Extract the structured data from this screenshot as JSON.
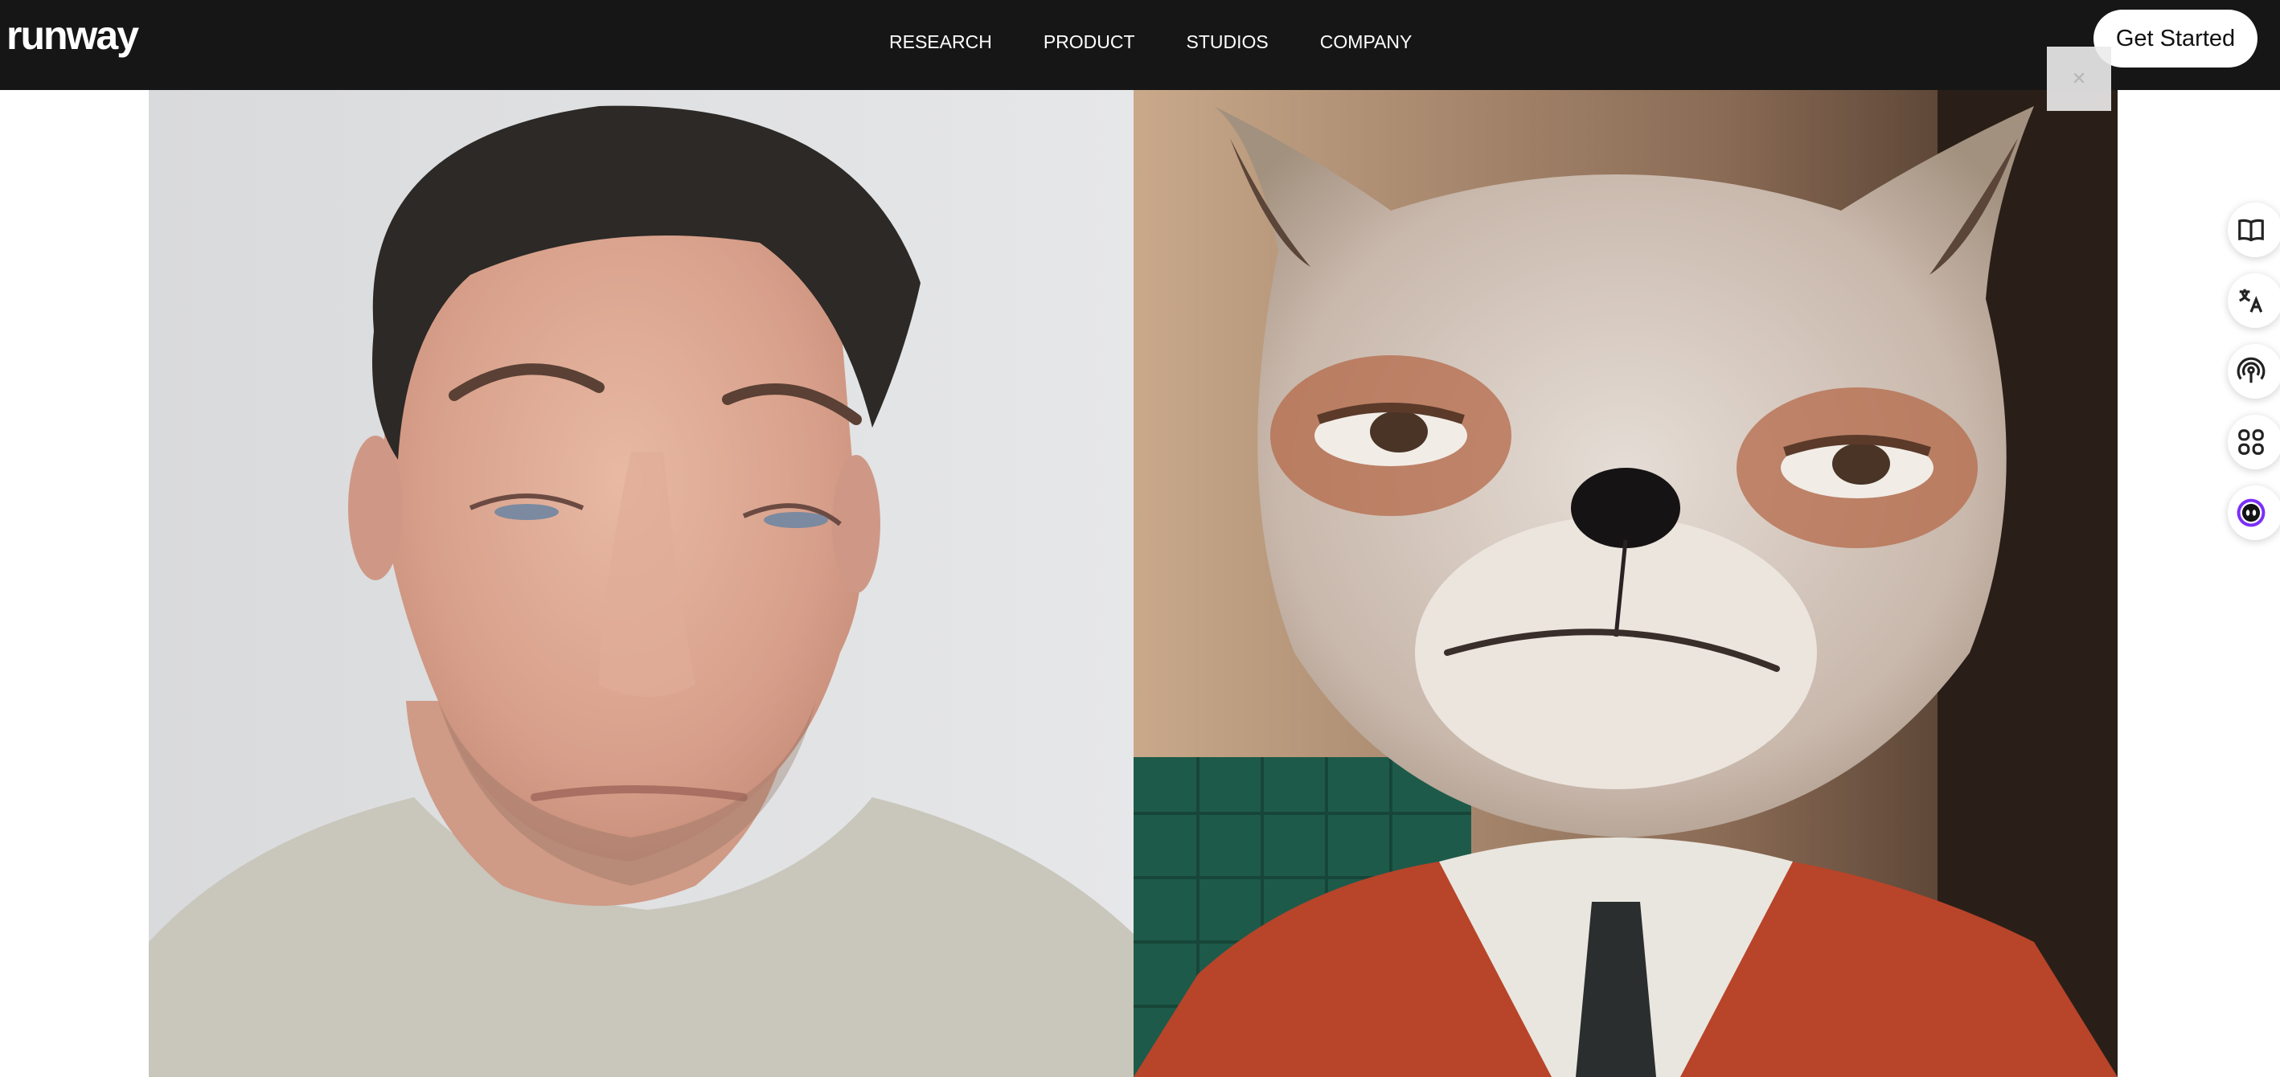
{
  "brand": {
    "logo_text": "runway"
  },
  "nav": {
    "items": [
      {
        "label": "RESEARCH"
      },
      {
        "label": "PRODUCT"
      },
      {
        "label": "STUDIOS"
      },
      {
        "label": "COMPANY"
      }
    ]
  },
  "header": {
    "cta_label": "Get Started"
  },
  "media": {
    "left_subject": "person-face",
    "right_subject": "stylized-fox-character"
  },
  "side_tools": {
    "items": [
      {
        "icon": "book-icon"
      },
      {
        "icon": "translate-icon"
      },
      {
        "icon": "podcast-icon"
      },
      {
        "icon": "apps-grid-icon"
      },
      {
        "icon": "assistant-icon"
      }
    ]
  },
  "colors": {
    "header_bg": "#161616",
    "cta_bg": "#ffffff",
    "fox_jacket": "#b8442a",
    "tile_green": "#1e5a4a"
  }
}
